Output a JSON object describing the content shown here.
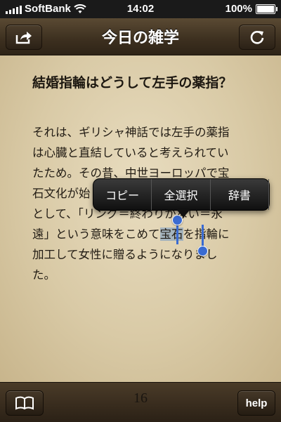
{
  "status": {
    "carrier": "SoftBank",
    "time": "14:02",
    "battery": "100%"
  },
  "nav": {
    "title": "今日の雑学"
  },
  "content": {
    "heading": "結婚指輪はどうして左手の薬指？",
    "lines": [
      "それは、ギリシャ神話では左手の薬指",
      "は心臓と直結していると考えられてい",
      "たため。その昔、中世ヨーロッパで宝",
      "石文化が始",
      "として、「リング＝終わりがない＝永",
      "遠」という意味をこめて",
      "宝石",
      "を指輪に",
      "加工して女性に贈るようになりまし",
      "た。"
    ]
  },
  "menu": {
    "copy": "コピー",
    "select_all": "全選択",
    "dictionary": "辞書"
  },
  "toolbar": {
    "page_number": "16",
    "help_label": "help"
  }
}
